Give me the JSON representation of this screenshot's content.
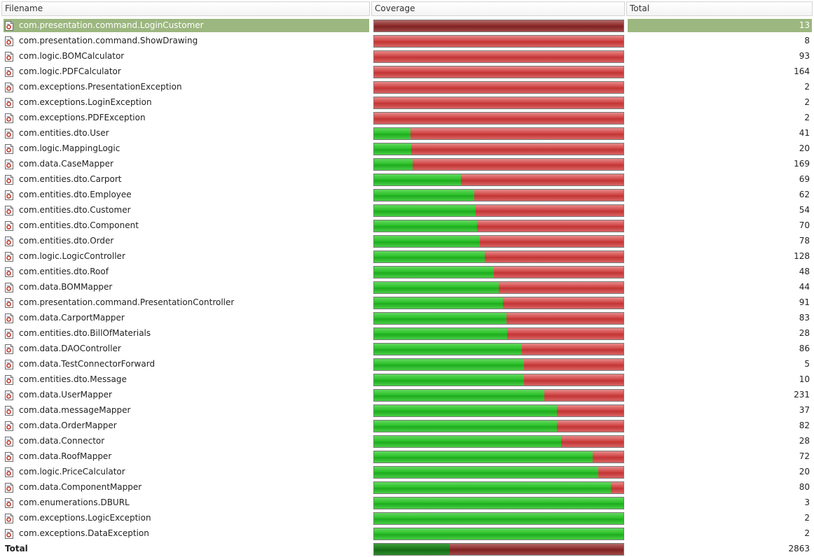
{
  "columns": {
    "filename": "Filename",
    "coverage": "Coverage",
    "total": "Total"
  },
  "colors": {
    "selection": "#9cb77f",
    "covered": "#2cc22a",
    "uncovered": "#c23434"
  },
  "icon": "java-source-file-icon",
  "rows": [
    {
      "name": "com.presentation.command.LoginCustomer",
      "coverage": 0,
      "total": "13",
      "selected": true
    },
    {
      "name": "com.presentation.command.ShowDrawing",
      "coverage": 0,
      "total": "8"
    },
    {
      "name": "com.logic.BOMCalculator",
      "coverage": 0,
      "total": "93"
    },
    {
      "name": "com.logic.PDFCalculator",
      "coverage": 0,
      "total": "164"
    },
    {
      "name": "com.exceptions.PresentationException",
      "coverage": 0,
      "total": "2"
    },
    {
      "name": "com.exceptions.LoginException",
      "coverage": 0,
      "total": "2"
    },
    {
      "name": "com.exceptions.PDFException",
      "coverage": 0,
      "total": "2"
    },
    {
      "name": "com.entities.dto.User",
      "coverage": 0.146,
      "total": "41"
    },
    {
      "name": "com.logic.MappingLogic",
      "coverage": 0.15,
      "total": "20"
    },
    {
      "name": "com.data.CaseMapper",
      "coverage": 0.155,
      "total": "169"
    },
    {
      "name": "com.entities.dto.Carport",
      "coverage": 0.348,
      "total": "69"
    },
    {
      "name": "com.entities.dto.Employee",
      "coverage": 0.403,
      "total": "62"
    },
    {
      "name": "com.entities.dto.Customer",
      "coverage": 0.407,
      "total": "54"
    },
    {
      "name": "com.entities.dto.Component",
      "coverage": 0.414,
      "total": "70"
    },
    {
      "name": "com.entities.dto.Order",
      "coverage": 0.423,
      "total": "78"
    },
    {
      "name": "com.logic.LogicController",
      "coverage": 0.445,
      "total": "128"
    },
    {
      "name": "com.entities.dto.Roof",
      "coverage": 0.479,
      "total": "48"
    },
    {
      "name": "com.data.BOMMapper",
      "coverage": 0.5,
      "total": "44"
    },
    {
      "name": "com.presentation.command.PresentationController",
      "coverage": 0.516,
      "total": "91"
    },
    {
      "name": "com.data.CarportMapper",
      "coverage": 0.53,
      "total": "83"
    },
    {
      "name": "com.entities.dto.BillOfMaterials",
      "coverage": 0.535,
      "total": "28"
    },
    {
      "name": "com.data.DAOController",
      "coverage": 0.593,
      "total": "86"
    },
    {
      "name": "com.data.TestConnectorForward",
      "coverage": 0.6,
      "total": "5"
    },
    {
      "name": "com.entities.dto.Message",
      "coverage": 0.6,
      "total": "10"
    },
    {
      "name": "com.data.UserMapper",
      "coverage": 0.683,
      "total": "231"
    },
    {
      "name": "com.data.messageMapper",
      "coverage": 0.732,
      "total": "37"
    },
    {
      "name": "com.data.OrderMapper",
      "coverage": 0.732,
      "total": "82"
    },
    {
      "name": "com.data.Connector",
      "coverage": 0.75,
      "total": "28"
    },
    {
      "name": "com.data.RoofMapper",
      "coverage": 0.875,
      "total": "72"
    },
    {
      "name": "com.logic.PriceCalculator",
      "coverage": 0.9,
      "total": "20"
    },
    {
      "name": "com.data.ComponentMapper",
      "coverage": 0.95,
      "total": "80"
    },
    {
      "name": "com.enumerations.DBURL",
      "coverage": 1,
      "total": "3"
    },
    {
      "name": "com.exceptions.LogicException",
      "coverage": 1,
      "total": "2"
    },
    {
      "name": "com.exceptions.DataException",
      "coverage": 1,
      "total": "2"
    }
  ],
  "summary": {
    "name": "Total",
    "coverage": 0.302,
    "total": "2863"
  }
}
